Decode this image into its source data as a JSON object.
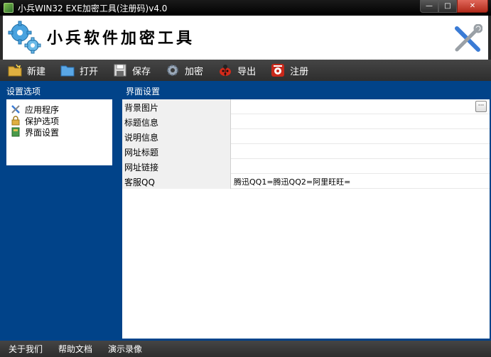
{
  "window": {
    "title": "小兵WIN32 EXE加密工具(注册码)v4.0",
    "min_glyph": "—",
    "max_glyph": "□",
    "close_glyph": "✕"
  },
  "banner": {
    "title": "小兵软件加密工具"
  },
  "toolbar": {
    "items": [
      {
        "label": "新建",
        "icon": "new-folder-icon"
      },
      {
        "label": "打开",
        "icon": "open-folder-icon"
      },
      {
        "label": "保存",
        "icon": "save-icon"
      },
      {
        "label": "加密",
        "icon": "gear-icon"
      },
      {
        "label": "导出",
        "icon": "ladybug-icon"
      },
      {
        "label": "注册",
        "icon": "phone-icon"
      }
    ]
  },
  "left_panel": {
    "header": "设置选项",
    "tree": [
      {
        "label": "应用程序",
        "icon": "tools-icon"
      },
      {
        "label": "保护选项",
        "icon": "lock-icon"
      },
      {
        "label": "界面设置",
        "icon": "book-icon"
      }
    ]
  },
  "right_panel": {
    "header": "界面设置",
    "rows": [
      {
        "key": "背景图片",
        "value": ""
      },
      {
        "key": "标题信息",
        "value": ""
      },
      {
        "key": "说明信息",
        "value": ""
      },
      {
        "key": "网址标题",
        "value": ""
      },
      {
        "key": "网址链接",
        "value": ""
      },
      {
        "key": "客服QQ",
        "value": "腾迅QQ1=腾迅QQ2=阿里旺旺="
      }
    ],
    "ellipsis_label": "···"
  },
  "footer": {
    "links": [
      "关于我们",
      "帮助文档",
      "演示录像"
    ]
  }
}
